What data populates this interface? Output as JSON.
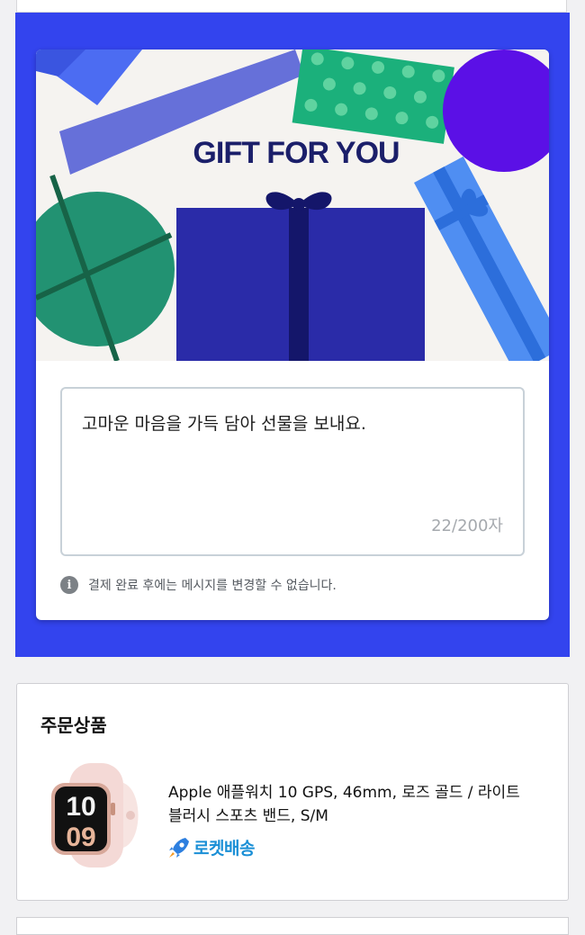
{
  "gift_card": {
    "banner_title": "GIFT FOR YOU",
    "message": {
      "value": "고마운 마음을 가득 담아 선물을 보내요.",
      "char_count": "22/200자"
    },
    "notice": "결제 완료 후에는 메시지를 변경할 수 없습니다.",
    "notice_icon": "info-icon"
  },
  "order": {
    "title": "주문상품",
    "product": {
      "name": "Apple 애플워치 10 GPS, 46mm, 로즈 골드 / 라이트 블러시 스포츠 밴드, S/M",
      "delivery_badge": "로켓배송",
      "badge_icon": "rocket-icon"
    }
  },
  "colors": {
    "section_bg": "#3344ee",
    "title_navy": "#1b1f6a",
    "rocket_blue": "#1a8fd6"
  }
}
